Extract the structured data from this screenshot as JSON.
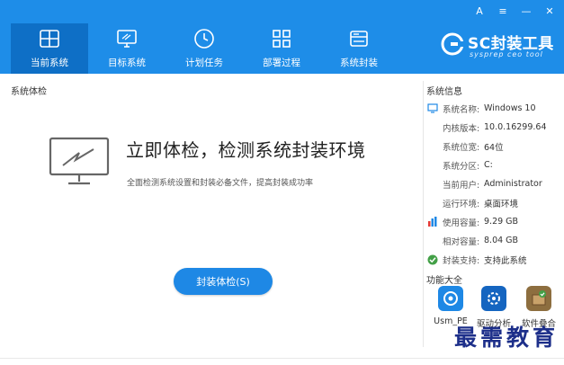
{
  "window": {
    "controls": [
      "A",
      "≡",
      "—",
      "✕"
    ]
  },
  "nav": {
    "tabs": [
      {
        "label": "当前系统",
        "icon": "windows-icon"
      },
      {
        "label": "目标系统",
        "icon": "monitor-icon"
      },
      {
        "label": "计划任务",
        "icon": "clock-icon"
      },
      {
        "label": "部署过程",
        "icon": "grid-icon"
      },
      {
        "label": "系统封装",
        "icon": "drive-icon"
      }
    ]
  },
  "brand": {
    "title": "SC封装工具",
    "subtitle": "sysprep ceo tool"
  },
  "main": {
    "section_title": "系统体检",
    "headline": "立即体检，检测系统封装环境",
    "description": "全面检测系统设置和封装必备文件，提高封装成功率",
    "button_label": "封装体检(S)"
  },
  "sidebar": {
    "section_title": "系统信息",
    "items": [
      {
        "key": "系统名称:",
        "value": "Windows 10",
        "icon": "monitor-icon"
      },
      {
        "key": "内核版本:",
        "value": "10.0.16299.64",
        "icon": ""
      },
      {
        "key": "系统位宽:",
        "value": "64位",
        "icon": ""
      },
      {
        "key": "系统分区:",
        "value": "C:",
        "icon": ""
      },
      {
        "key": "当前用户:",
        "value": "Administrator",
        "icon": ""
      },
      {
        "key": "运行环境:",
        "value": "桌面环境",
        "icon": ""
      },
      {
        "key": "使用容量:",
        "value": "9.29 GB",
        "icon": "bar-chart-icon"
      },
      {
        "key": "相对容量:",
        "value": "8.04 GB",
        "icon": ""
      },
      {
        "key": "封装支持:",
        "value": "支持此系统",
        "icon": "check-circle-icon"
      }
    ],
    "functions_title": "功能大全",
    "functions": [
      {
        "label": "Usm_PE",
        "icon": "pe-icon"
      },
      {
        "label": "驱动分析",
        "icon": "driver-icon"
      },
      {
        "label": "软件叠合",
        "icon": "package-icon"
      }
    ]
  },
  "watermark": "最需教育",
  "colors": {
    "header": "#1e8de8",
    "active_tab": "#0e6fc6",
    "button": "#1e88e5",
    "watermark": "#1d2f8a"
  }
}
